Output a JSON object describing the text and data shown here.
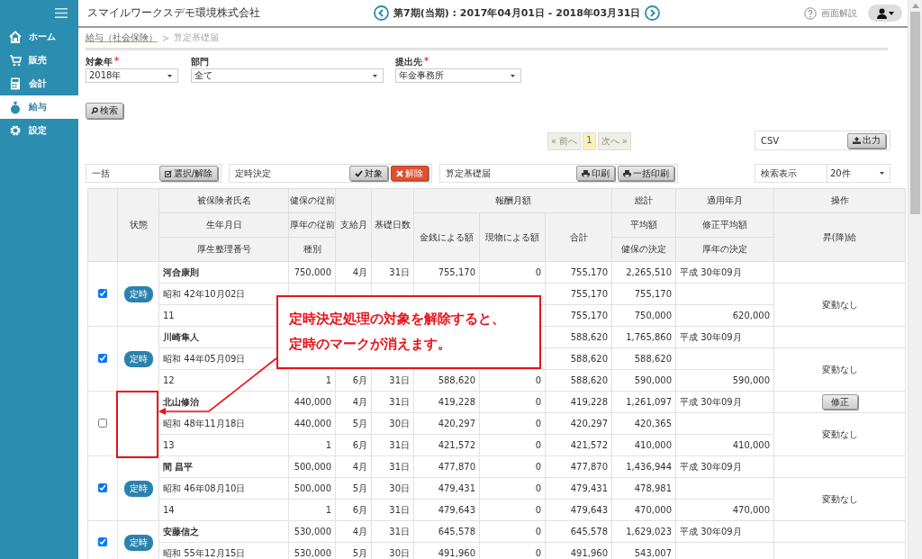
{
  "sidebar": {
    "items": [
      {
        "label": "ホーム",
        "selected": false
      },
      {
        "label": "販売",
        "selected": false
      },
      {
        "label": "会計",
        "selected": false
      },
      {
        "label": "給与",
        "selected": true
      },
      {
        "label": "設定",
        "selected": false
      }
    ]
  },
  "header": {
    "company": "スマイルワークスデモ環境株式会社",
    "period": "第7期(当期) : 2017年04月01日 - 2018年03月31日",
    "help": "画面解説"
  },
  "breadcrumb": {
    "items": [
      {
        "label": "給与（社会保険）"
      },
      {
        "label": "算定基礎届"
      }
    ],
    "separator": ">"
  },
  "filters": {
    "required_mark": "*",
    "items": [
      {
        "label": "対象年",
        "required": true,
        "value": "2018年"
      },
      {
        "label": "部門",
        "required": false,
        "value": "全て"
      },
      {
        "label": "提出先",
        "required": true,
        "value": "年金事務所"
      }
    ]
  },
  "search_button": "検索",
  "pagination": {
    "prev": "« 前へ",
    "pages": [
      {
        "label": "1",
        "selected": true
      }
    ],
    "next": "次へ »"
  },
  "csv": {
    "label": "CSV",
    "button": "出力"
  },
  "toolbar": [
    {
      "label": "一括",
      "buttons": [
        {
          "label": "選択/解除",
          "kind": "check"
        }
      ]
    },
    {
      "label": "定時決定",
      "buttons": [
        {
          "label": "対象",
          "kind": "ok"
        },
        {
          "label": "解除",
          "kind": "danger"
        }
      ]
    },
    {
      "label": "算定基礎届",
      "buttons": [
        {
          "label": "印刷",
          "kind": "print"
        },
        {
          "label": "一括印刷",
          "kind": "print"
        }
      ]
    }
  ],
  "page_size": {
    "label": "検索表示",
    "value": "20件"
  },
  "table": {
    "header": {
      "status": "状態",
      "name": [
        "被保険者氏名",
        "生年月日",
        "厚生整理番号"
      ],
      "prior": [
        "健保の従前",
        "厚年の従前",
        "種別"
      ],
      "pay_month": "支給月",
      "base_days": "基礎日数",
      "remuneration": "報酬月額",
      "cash": "金銭による額",
      "in_kind": "現物による額",
      "total": "合計",
      "grand": [
        "総計",
        "平均額",
        "健保の決定"
      ],
      "applied": [
        "適用年月",
        "修正平均額",
        "厚年の決定"
      ],
      "operation": [
        "操作",
        "昇(降)給"
      ]
    },
    "rows": [
      {
        "checked": true,
        "status": "定時",
        "op_text": "変動なし",
        "lines": [
          {
            "person": "河合康則",
            "prior": "750,000",
            "pay_month": "4月",
            "base_days": "31日",
            "cash": "755,170",
            "in_kind": "0",
            "total": "755,170",
            "grand": "2,265,510",
            "applied": "平成 30年09月"
          },
          {
            "person": "昭和 42年10月02日",
            "total": "755,170",
            "grand": "755,170"
          },
          {
            "person": "11",
            "total": "755,170",
            "grand": "750,000",
            "applied": "620,000"
          }
        ]
      },
      {
        "checked": true,
        "status": "定時",
        "op_text": "変動なし",
        "lines": [
          {
            "person": "川崎隼人",
            "total": "588,620",
            "grand": "1,765,860",
            "applied": "平成 30年09月"
          },
          {
            "person": "昭和 44年05月09日",
            "total": "588,620",
            "grand": "588,620"
          },
          {
            "person": "12",
            "prior": "1",
            "pay_month": "6月",
            "base_days": "31日",
            "cash": "588,620",
            "in_kind": "0",
            "total": "588,620",
            "grand": "590,000",
            "applied": "590,000"
          }
        ]
      },
      {
        "checked": false,
        "op_button": "修正",
        "op_text": "変動なし",
        "lines": [
          {
            "person": "北山修治",
            "prior": "440,000",
            "pay_month": "4月",
            "base_days": "31日",
            "cash": "419,228",
            "in_kind": "0",
            "total": "419,228",
            "grand": "1,261,097",
            "applied": "平成 30年09月"
          },
          {
            "person": "昭和 48年11月18日",
            "prior": "440,000",
            "pay_month": "5月",
            "base_days": "30日",
            "cash": "420,297",
            "in_kind": "0",
            "total": "420,297",
            "grand": "420,365"
          },
          {
            "person": "13",
            "prior": "1",
            "pay_month": "6月",
            "base_days": "31日",
            "cash": "421,572",
            "in_kind": "0",
            "total": "421,572",
            "grand": "410,000",
            "applied": "410,000"
          }
        ]
      },
      {
        "checked": true,
        "status": "定時",
        "op_text": "変動なし",
        "lines": [
          {
            "person": "間 昌平",
            "prior": "500,000",
            "pay_month": "4月",
            "base_days": "31日",
            "cash": "477,870",
            "in_kind": "0",
            "total": "477,870",
            "grand": "1,436,944",
            "applied": "平成 30年09月"
          },
          {
            "person": "昭和 46年08月10日",
            "prior": "500,000",
            "pay_month": "5月",
            "base_days": "30日",
            "cash": "479,431",
            "in_kind": "0",
            "total": "479,431",
            "grand": "478,981"
          },
          {
            "person": "14",
            "prior": "1",
            "pay_month": "6月",
            "base_days": "31日",
            "cash": "479,643",
            "in_kind": "0",
            "total": "479,643",
            "grand": "470,000",
            "applied": "470,000"
          }
        ]
      },
      {
        "checked": true,
        "status": "定時",
        "lines": [
          {
            "person": "安藤信之",
            "prior": "530,000",
            "pay_month": "4月",
            "base_days": "31日",
            "cash": "645,578",
            "in_kind": "0",
            "total": "645,578",
            "grand": "1,629,023",
            "applied": "平成 30年09月"
          },
          {
            "person": "昭和 55年12月15日",
            "prior": "530,000",
            "pay_month": "5月",
            "base_days": "30日",
            "cash": "491,960",
            "in_kind": "0",
            "total": "491,960",
            "grand": "543,007"
          }
        ]
      }
    ]
  },
  "callout": {
    "text": "定時決定処理の対象を解除すると、定時のマークが消えます。"
  }
}
